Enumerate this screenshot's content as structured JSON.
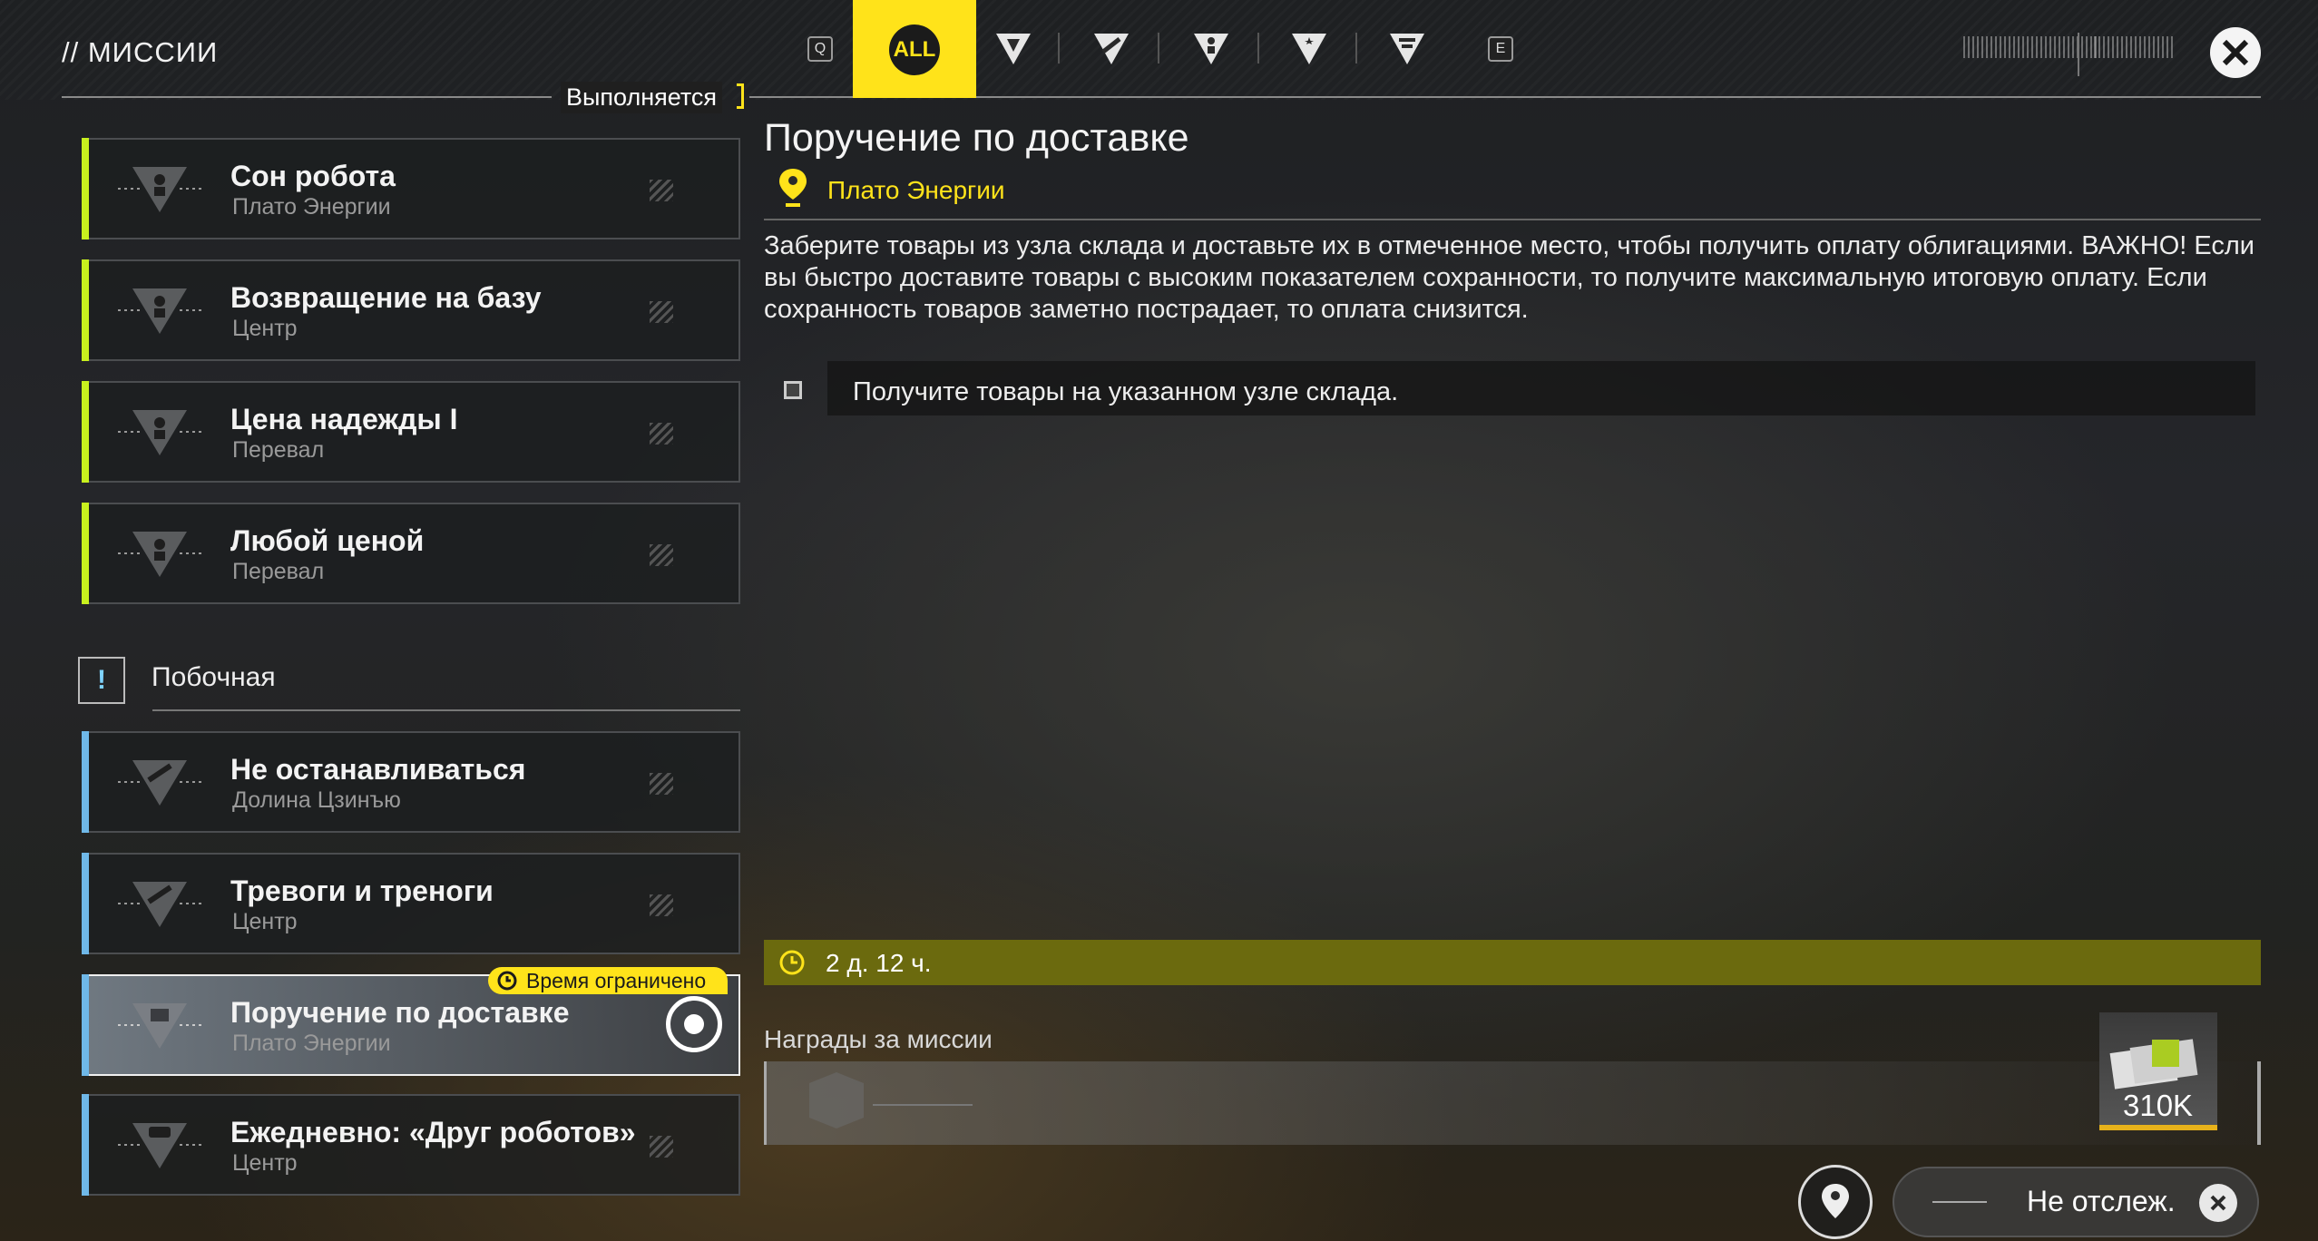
{
  "header": {
    "title": "// МИССИИ",
    "status": "Выполняется",
    "key_left": "Q",
    "key_right": "E",
    "filter_all": "ALL"
  },
  "filters": [
    {
      "icon": "endfield-faction-icon"
    },
    {
      "icon": "arrow-triangle-icon"
    },
    {
      "icon": "person-triangle-icon"
    },
    {
      "icon": "star-triangle-icon"
    },
    {
      "icon": "grid-triangle-icon"
    }
  ],
  "missions_main": [
    {
      "name": "Сон робота",
      "location": "Плато Энергии"
    },
    {
      "name": "Возвращение на базу",
      "location": "Центр"
    },
    {
      "name": "Цена надежды I",
      "location": "Перевал"
    },
    {
      "name": "Любой ценой",
      "location": "Перевал"
    }
  ],
  "section": {
    "icon_glyph": "!",
    "label": "Побочная"
  },
  "missions_side": [
    {
      "name": "Не останавливаться",
      "location": "Долина Цзинъю"
    },
    {
      "name": "Тревоги и треноги",
      "location": "Центр"
    },
    {
      "name": "Поручение по доставке",
      "location": "Плато Энергии",
      "badge": "Время ограничено"
    },
    {
      "name": "Ежедневно: «Друг роботов»",
      "location": "Центр"
    }
  ],
  "detail": {
    "title": "Поручение по доставке",
    "location": "Плато Энергии",
    "description": "Заберите товары из узла склада и доставьте их в отмеченное место, чтобы получить оплату облигациями. ВАЖНО! Если вы быстро доставите товары с высоким показателем сохранности, то получите максимальную итоговую оплату. Если сохранность товаров заметно пострадает, то оплата снизится.",
    "objective": "Получите товары на указанном узле склада.",
    "timer": "2 д. 12 ч.",
    "rewards_label": "Награды за миссии",
    "reward_count": "310K",
    "untrack_label": "Не отслеж."
  },
  "colors": {
    "accent": "#ffe31a",
    "main_bar": "#c8f01e",
    "side_bar": "#6fb8e8"
  }
}
